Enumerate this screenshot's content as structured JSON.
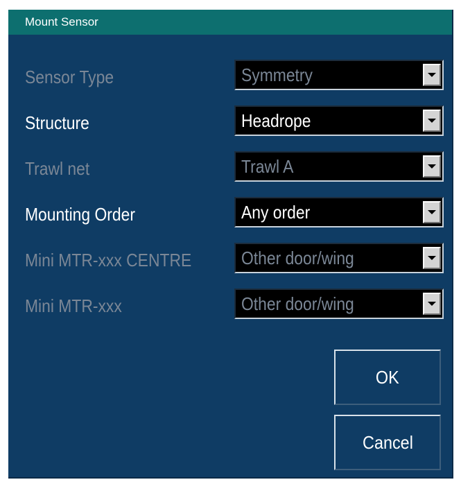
{
  "dialog": {
    "title": "Mount Sensor",
    "fields": [
      {
        "label": "Sensor Type",
        "value": "Symmetry",
        "enabled": false
      },
      {
        "label": "Structure",
        "value": "Headrope",
        "enabled": true
      },
      {
        "label": "Trawl net",
        "value": "Trawl A",
        "enabled": false
      },
      {
        "label": "Mounting Order",
        "value": "Any order",
        "enabled": true
      },
      {
        "label": "Mini MTR-xxx CENTRE",
        "value": "Other door/wing",
        "enabled": false
      },
      {
        "label": "Mini MTR-xxx",
        "value": "Other door/wing",
        "enabled": false
      }
    ],
    "ok_label": "OK",
    "cancel_label": "Cancel"
  },
  "colors": {
    "dialog_bg": "#0f3c64",
    "titlebar_bg": "#0d6f6f",
    "enabled_text": "#ffffff",
    "disabled_text": "#7b8796"
  }
}
